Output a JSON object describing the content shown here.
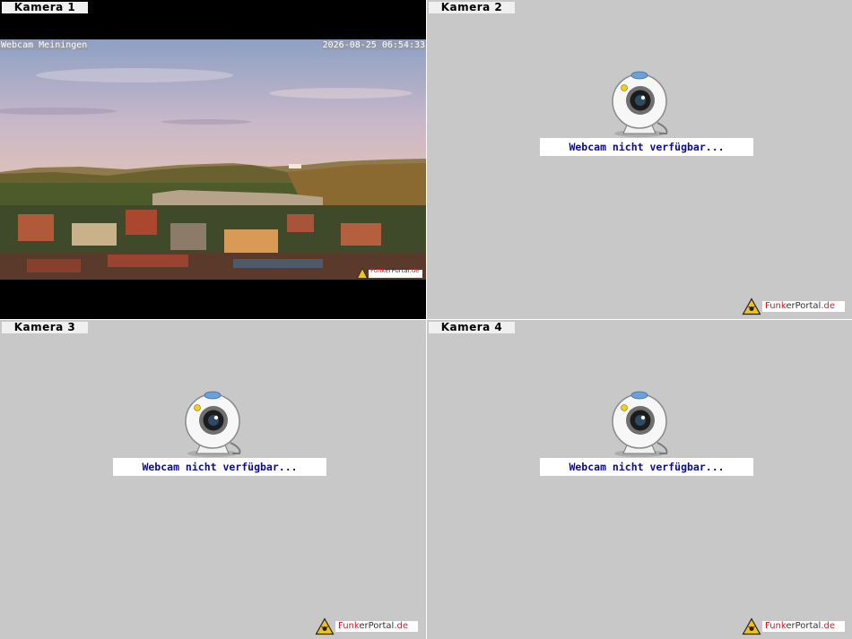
{
  "cameras": [
    {
      "tab_label": "Kamera 1",
      "status": "live",
      "overlay_left": "Webcam Meiningen",
      "overlay_right": "2026-08-25 06:54:33"
    },
    {
      "tab_label": "Kamera 2",
      "status": "unavailable",
      "message": "Webcam nicht verfügbar..."
    },
    {
      "tab_label": "Kamera 3",
      "status": "unavailable",
      "message": "Webcam nicht verfügbar..."
    },
    {
      "tab_label": "Kamera 4",
      "status": "unavailable",
      "message": "Webcam nicht verfügbar..."
    }
  ],
  "brand": {
    "part1": "Funk",
    "part2": "er",
    "part3": "Portal",
    "part4": ".de"
  },
  "colors": {
    "pane_bg": "#c8c8c8",
    "message_text": "#0b0b8a",
    "brand_red": "#e0141e"
  },
  "icons": [
    "webcam-icon",
    "warning-triangle-icon"
  ]
}
